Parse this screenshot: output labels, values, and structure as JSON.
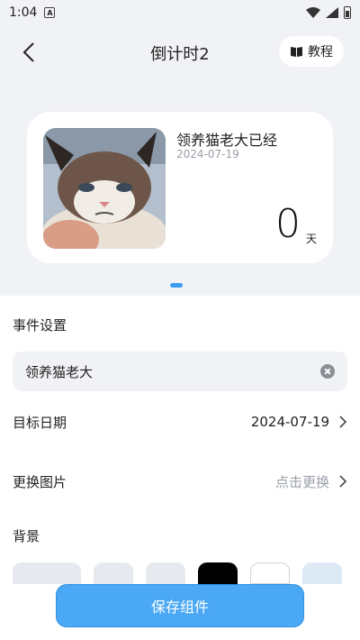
{
  "status_bar": {
    "time": "1:04",
    "notification_letter": "A"
  },
  "header": {
    "title": "倒计时2",
    "tutorial_label": "教程"
  },
  "preview": {
    "event_title": "领养猫老大已经",
    "event_date": "2024-07-19",
    "day_count": "0",
    "day_unit": "天"
  },
  "settings": {
    "event_section_label": "事件设置",
    "event_name_value": "领养猫老大",
    "target_date_label": "目标日期",
    "target_date_value": "2024-07-19",
    "change_image_label": "更换图片",
    "change_image_hint": "点击更换",
    "background_label": "背景",
    "background_swatches": [
      "#e6e9ee",
      "#e6e9ee",
      "#e6e9ee",
      "#000000",
      "#ffffff",
      "#dde9f5"
    ]
  },
  "save_button_label": "保存组件",
  "colors": {
    "accent": "#4aa8f4",
    "indicator": "#3a9cf2"
  }
}
